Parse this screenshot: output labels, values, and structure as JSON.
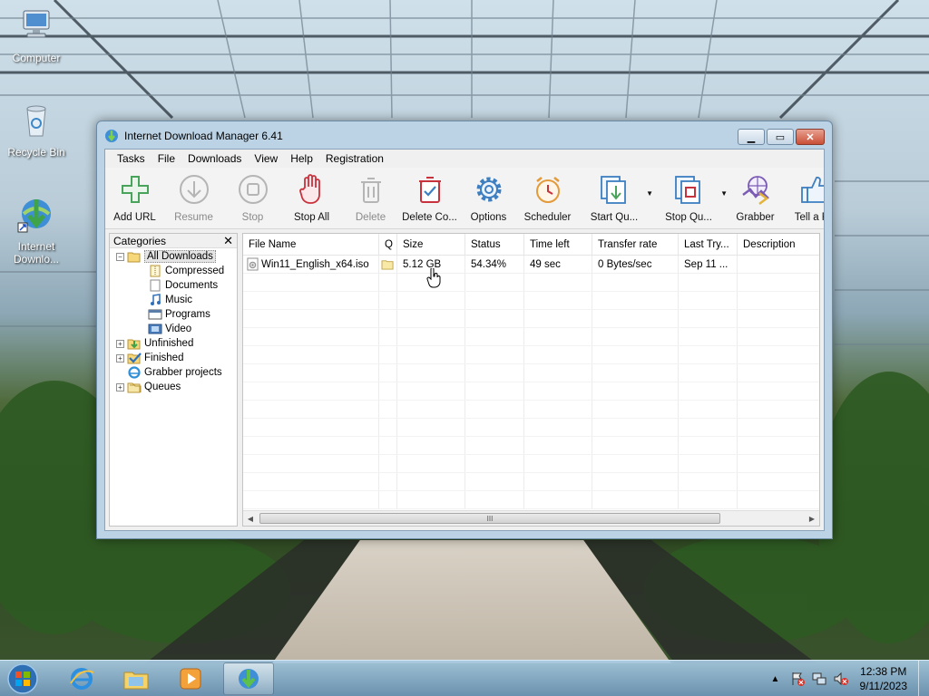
{
  "desktop": {
    "icons": [
      {
        "label": "Computer"
      },
      {
        "label": "Recycle Bin"
      },
      {
        "label": "Internet Downlo..."
      }
    ]
  },
  "window": {
    "title": "Internet Download Manager 6.41",
    "menu": [
      "Tasks",
      "File",
      "Downloads",
      "View",
      "Help",
      "Registration"
    ],
    "toolbar": [
      {
        "label": "Add URL",
        "icon": "plus-icon",
        "enabled": true
      },
      {
        "label": "Resume",
        "icon": "download-arrow-icon",
        "enabled": false
      },
      {
        "label": "Stop",
        "icon": "stop-icon",
        "enabled": false
      },
      {
        "label": "Stop All",
        "icon": "hand-icon",
        "enabled": true
      },
      {
        "label": "Delete",
        "icon": "trash-icon",
        "enabled": false
      },
      {
        "label": "Delete Co...",
        "icon": "delete-completed-icon",
        "enabled": true
      },
      {
        "label": "Options",
        "icon": "gear-icon",
        "enabled": true
      },
      {
        "label": "Scheduler",
        "icon": "alarm-clock-icon",
        "enabled": true
      },
      {
        "label": "Start Qu...",
        "icon": "start-queue-icon",
        "enabled": true
      },
      {
        "label": "Stop Qu...",
        "icon": "stop-queue-icon",
        "enabled": true
      },
      {
        "label": "Grabber",
        "icon": "grabber-icon",
        "enabled": true
      },
      {
        "label": "Tell a Fri",
        "icon": "thumbs-up-icon",
        "enabled": true
      }
    ],
    "categories": {
      "header": "Categories",
      "close": "✕",
      "items": [
        {
          "label": "All Downloads",
          "level": 0,
          "expander": "−",
          "selected": true
        },
        {
          "label": "Compressed",
          "level": 1
        },
        {
          "label": "Documents",
          "level": 1
        },
        {
          "label": "Music",
          "level": 1
        },
        {
          "label": "Programs",
          "level": 1
        },
        {
          "label": "Video",
          "level": 1
        },
        {
          "label": "Unfinished",
          "level": 0,
          "expander": "+"
        },
        {
          "label": "Finished",
          "level": 0,
          "expander": "+"
        },
        {
          "label": "Grabber projects",
          "level": 0,
          "expander": ""
        },
        {
          "label": "Queues",
          "level": 0,
          "expander": "+"
        }
      ]
    },
    "columns": [
      "File Name",
      "Q",
      "Size",
      "Status",
      "Time left",
      "Transfer rate",
      "Last Try...",
      "Description"
    ],
    "rows": [
      {
        "file_name": "Win11_English_x64.iso",
        "q": "",
        "size": "5.12  GB",
        "status": "54.34%",
        "time_left": "49 sec",
        "transfer_rate": "0  Bytes/sec",
        "last_try": "Sep 11 ...",
        "description": ""
      }
    ],
    "scroll_grip": "III"
  },
  "taskbar": {
    "time": "12:38 PM",
    "date": "9/11/2023"
  },
  "colors": {
    "accent_green": "#4aa35a",
    "stop_red": "#c8323c",
    "options_blue": "#3d7fc1"
  }
}
